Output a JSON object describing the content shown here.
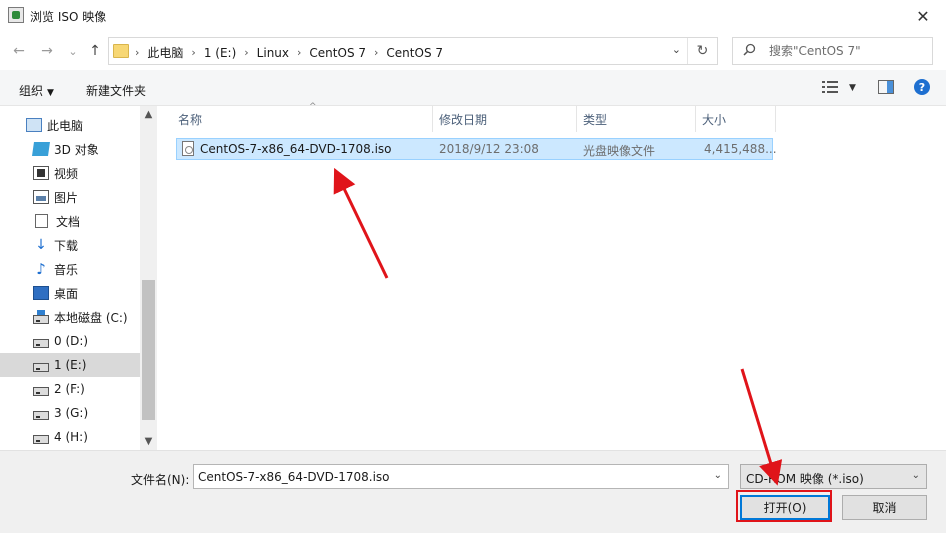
{
  "window": {
    "title": "浏览 ISO 映像",
    "close_glyph": "✕"
  },
  "nav": {
    "back_glyph": "←",
    "forward_glyph": "→",
    "recent_glyph": "⌄",
    "up_glyph": "↑",
    "breadcrumbs": [
      "此电脑",
      "1 (E:)",
      "Linux",
      "CentOS 7",
      "CentOS 7"
    ],
    "separator": "›",
    "dropdown_glyph": "⌄",
    "refresh_glyph": "↻",
    "search_placeholder": "搜索\"CentOS 7\""
  },
  "toolbar": {
    "organize_label": "组织",
    "organize_caret": "▼",
    "new_folder_label": "新建文件夹",
    "view_caret": "▼",
    "help_label": "?"
  },
  "sidebar": {
    "items": [
      {
        "label": "此电脑",
        "icon": "pc"
      },
      {
        "label": "3D 对象",
        "icon": "obj3d"
      },
      {
        "label": "视频",
        "icon": "video"
      },
      {
        "label": "图片",
        "icon": "pic"
      },
      {
        "label": "文档",
        "icon": "doc"
      },
      {
        "label": "下载",
        "icon": "down"
      },
      {
        "label": "音乐",
        "icon": "music"
      },
      {
        "label": "桌面",
        "icon": "desk"
      },
      {
        "label": "本地磁盘 (C:)",
        "icon": "drive"
      },
      {
        "label": "0 (D:)",
        "icon": "drive"
      },
      {
        "label": "1 (E:)",
        "icon": "drive"
      },
      {
        "label": "2 (F:)",
        "icon": "drive"
      },
      {
        "label": "3 (G:)",
        "icon": "drive"
      },
      {
        "label": "4 (H:)",
        "icon": "drive"
      }
    ],
    "scroll_up_glyph": "▲",
    "scroll_down_glyph": "▼"
  },
  "columns": {
    "name": "名称",
    "date": "修改日期",
    "type": "类型",
    "size": "大小",
    "sort_glyph": "^"
  },
  "files": [
    {
      "name": "CentOS-7-x86_64-DVD-1708.iso",
      "date": "2018/9/12 23:08",
      "type": "光盘映像文件",
      "size": "4,415,488..."
    }
  ],
  "footer": {
    "filename_label": "文件名(N):",
    "filename_value": "CentOS-7-x86_64-DVD-1708.iso",
    "filetype_value": "CD-ROM 映像 (*.iso)",
    "dropdown_glyph": "⌄",
    "open_label": "打开(O)",
    "cancel_label": "取消"
  },
  "colors": {
    "selection": "#cce8ff",
    "annotation": "#e0141a",
    "accent": "#0078d7"
  }
}
